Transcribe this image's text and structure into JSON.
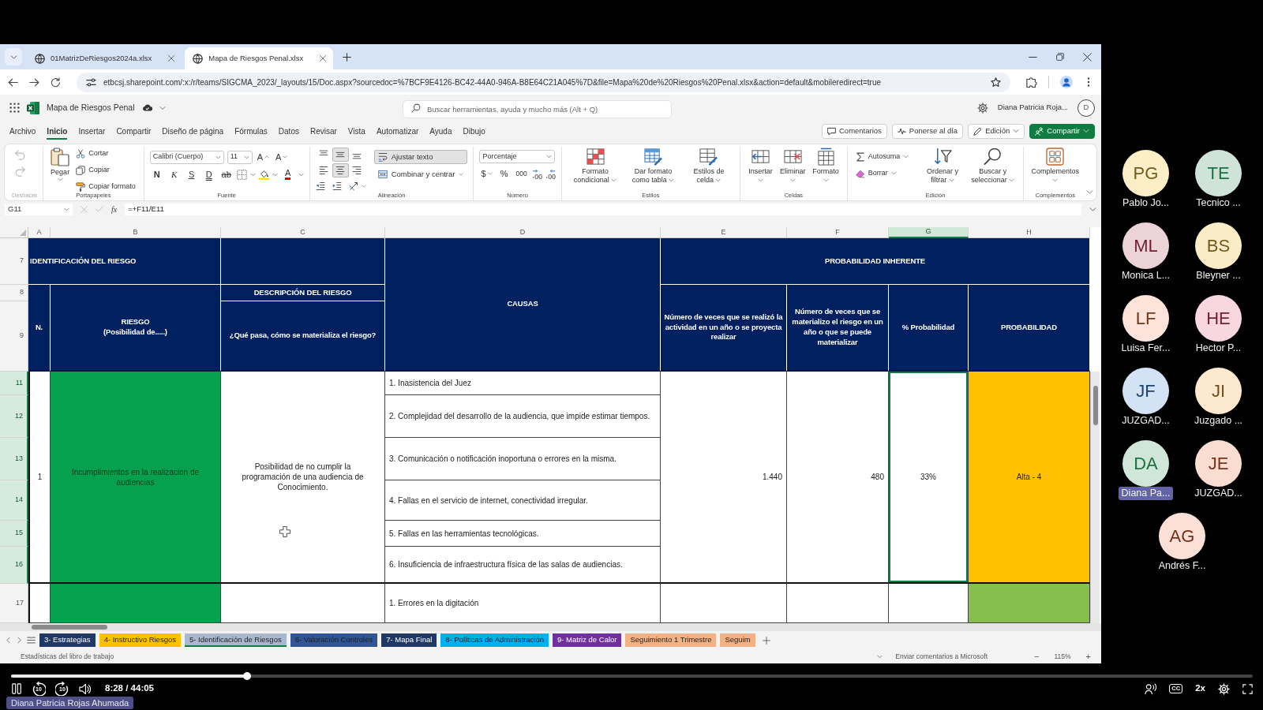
{
  "browser": {
    "tabs": [
      {
        "title": "01MatrizDeRiesgos2024a.xlsx",
        "selected": false
      },
      {
        "title": "Mapa de Riesgos Penal.xlsx",
        "selected": true
      }
    ],
    "url": "etbcsj.sharepoint.com/:x:/r/teams/SIGCMA_2023/_layouts/15/Doc.aspx?sourcedoc=%7BCF9E4126-BC42-44A0-946A-B8E64C21A045%7D&file=Mapa%20de%20Riesgos%20Penal.xlsx&action=default&mobileredirect=true"
  },
  "app": {
    "file_name": "Mapa de Riesgos Penal",
    "search": {
      "placeholder": "Buscar herramientas, ayuda y mucho más (Alt + Q)"
    },
    "user_name": "Diana Patricia Roja...",
    "user_initial": "D"
  },
  "menu_tabs": [
    {
      "label": "Archivo",
      "selected": false
    },
    {
      "label": "Inicio",
      "selected": true
    },
    {
      "label": "Insertar",
      "selected": false
    },
    {
      "label": "Compartir",
      "selected": false
    },
    {
      "label": "Diseño de página",
      "selected": false
    },
    {
      "label": "Fórmulas",
      "selected": false
    },
    {
      "label": "Datos",
      "selected": false
    },
    {
      "label": "Revisar",
      "selected": false
    },
    {
      "label": "Vista",
      "selected": false
    },
    {
      "label": "Automatizar",
      "selected": false
    },
    {
      "label": "Ayuda",
      "selected": false
    },
    {
      "label": "Dibujo",
      "selected": false
    }
  ],
  "actions": [
    {
      "label": "Comentarios",
      "kind": "comments"
    },
    {
      "label": "Ponerse al día",
      "kind": "catch-up"
    },
    {
      "label": "Edición",
      "kind": "mode"
    },
    {
      "label": "Compartir",
      "kind": "share"
    }
  ],
  "ribbon": [
    {
      "label": "Deshacer",
      "kind": "undo",
      "disabled": true
    },
    {
      "label": "Portapapeles",
      "kind": "clipboard",
      "paste": "Pegar",
      "items": [
        {
          "label": "Cortar",
          "kind": "cut"
        },
        {
          "label": "Copiar",
          "kind": "copy"
        },
        {
          "label": "Copiar formato",
          "kind": "format-painter"
        }
      ]
    },
    {
      "label": "Fuente",
      "kind": "font",
      "font": "Calibri (Cuerpo)",
      "size": "11",
      "grow": "A",
      "shrink": "A",
      "styles": [
        {
          "label": "N",
          "kind": "bold"
        },
        {
          "label": "K",
          "kind": "italic"
        },
        {
          "label": "S",
          "kind": "underline"
        },
        {
          "label": "D",
          "kind": "double-underline"
        },
        {
          "label": "ab",
          "kind": "strikethrough"
        }
      ],
      "font_color": "A"
    },
    {
      "label": "Alineación",
      "kind": "alignment",
      "vertical_align": [
        {
          "kind": "top",
          "selected": false
        },
        {
          "kind": "middle",
          "selected": true
        },
        {
          "kind": "bottom",
          "selected": false
        }
      ],
      "horizontal_align": [
        {
          "kind": "left",
          "selected": false
        },
        {
          "kind": "center",
          "selected": true
        },
        {
          "kind": "right",
          "selected": false
        }
      ],
      "wrap": {
        "label": "Ajustar texto",
        "on": true
      },
      "merge": "Combinar y centrar"
    },
    {
      "label": "Número",
      "kind": "number",
      "format": "Porcentaje",
      "symbols": [
        {
          "label": "$",
          "kind": "currency"
        },
        {
          "label": "%",
          "kind": "percent"
        },
        {
          "label": "000",
          "kind": "thousands"
        }
      ]
    },
    {
      "label": "Estilos",
      "kind": "buttons",
      "items": [
        {
          "label": "Formato condicional",
          "kind": "conditional"
        },
        {
          "label": "Dar formato como tabla",
          "kind": "table"
        },
        {
          "label": "Estilos de celda",
          "kind": "cell-styles"
        }
      ]
    },
    {
      "label": "Celdas",
      "kind": "buttons",
      "items": [
        {
          "label": "Insertar",
          "kind": "insert"
        },
        {
          "label": "Eliminar",
          "kind": "delete"
        },
        {
          "label": "Formato",
          "kind": "format"
        }
      ]
    },
    {
      "label": "Edición",
      "kind": "buttons",
      "items": [
        {
          "label": "Autosuma",
          "kind": "autosum"
        },
        {
          "label": "Borrar",
          "kind": "clear"
        },
        {
          "label": "Ordenar y filtrar",
          "kind": "sort"
        },
        {
          "label": "Buscar y seleccionar",
          "kind": "find"
        }
      ]
    },
    {
      "label": "Complementos",
      "kind": "buttons",
      "items": [
        {
          "label": "Complementos",
          "kind": "add-ins"
        }
      ]
    }
  ],
  "formula_bar": {
    "name_box": "G11",
    "fx": "fx",
    "formula": "=+F11/E11"
  },
  "sheet": {
    "columns": [
      {
        "label": "A",
        "selected": false
      },
      {
        "label": "B",
        "selected": false
      },
      {
        "label": "C",
        "selected": false
      },
      {
        "label": "D",
        "selected": false
      },
      {
        "label": "E",
        "selected": false
      },
      {
        "label": "F",
        "selected": false
      },
      {
        "label": "G",
        "selected": true
      },
      {
        "label": "H",
        "selected": false
      }
    ],
    "rows": [
      {
        "label": "7",
        "selected": false
      },
      {
        "label": "8",
        "selected": false
      },
      {
        "label": "9",
        "selected": false
      },
      {
        "label": "11",
        "selected": true
      },
      {
        "label": "12",
        "selected": true
      },
      {
        "label": "13",
        "selected": true
      },
      {
        "label": "14",
        "selected": true
      },
      {
        "label": "15",
        "selected": true
      },
      {
        "label": "16",
        "selected": true
      },
      {
        "label": "17",
        "selected": false
      }
    ],
    "header": {
      "identification": "IDENTIFICACIÓN DEL RIESGO",
      "causes": "CAUSAS",
      "inherent_probability": "PROBABILIDAD INHERENTE",
      "number": "N.",
      "risk": "RIESGO\n(Posibilidad de.....)",
      "description_group": "DESCRIPCIÓN DEL RIESGO",
      "description": "¿Qué pasa, cómo se materializa el riesgo?",
      "times_performed": "Número de veces que se realizó la actividad en un año o se proyecta realizar",
      "times_materialized": "Número de veces que se materializo el riesgo en un año o que se puede materializar",
      "probability_pct": "% Probabilidad",
      "probability": "PROBABILIDAD"
    },
    "risks": [
      {
        "number": "1",
        "risk": "Incumplimientos en la realizacion de audiencias",
        "description": "Posibilidad de no cumplir la programación de una audiencia de Conocimiento.",
        "causes": [
          "1. Inasistencia del Juez",
          "2. Complejidad del desarrollo de la audiencia, que impide estimar tiempos.",
          "3. Comunicación o notificación inoportuna o errores en la misma.",
          "4. Fallas en el servicio de internet, conectividad irregular.",
          "5. Fallas en las herramientas tecnológicas.",
          "6. Insuficiencia de infraestructura física de las salas de audiencias."
        ],
        "times_performed": "1.440",
        "times_materialized": "480",
        "probability_pct": {
          "value": "33%",
          "selected": true
        },
        "probability": {
          "label": "Alta - 4",
          "color": "#ffc000"
        }
      },
      {
        "causes": [
          "1. Errores en la digitación"
        ],
        "probability_pct": {
          "selected": false
        },
        "probability": {
          "color": "#86bf4e"
        }
      }
    ]
  },
  "sheet_tabs": [
    {
      "label": "3- Estrategias",
      "color": "#203864",
      "selected": false
    },
    {
      "label": "4- Instructivo Riesgos",
      "color": "#ffc000",
      "selected": false
    },
    {
      "label": "5- Identificación de Riesgos",
      "color": "#a9b7cf",
      "selected": true
    },
    {
      "label": "6- Valoración Controles",
      "color": "#2f5597",
      "selected": false
    },
    {
      "label": "7- Mapa Final",
      "color": "#203864",
      "selected": false
    },
    {
      "label": "8- Políticas de Administración",
      "color": "#00b0f0",
      "selected": false
    },
    {
      "label": "9- Matriz de Calor",
      "color": "#7030a0",
      "selected": false
    },
    {
      "label": "Seguimiento 1 Trimestre",
      "color": "#f4b183",
      "selected": false
    },
    {
      "label": "Seguim",
      "color": "#f4b183",
      "selected": false
    }
  ],
  "status_bar": {
    "statistics": "Estadísticas del libro de trabajo",
    "feedback": "Enviar comentarios a Microsoft",
    "zoom_out": "−",
    "zoom": "115%",
    "zoom_in": "+"
  },
  "participants": [
    {
      "initials": "PG",
      "name": "Pablo Jo...",
      "color": "#fcefc7",
      "highlighted": false
    },
    {
      "initials": "TE",
      "name": "Tecnico ...",
      "color": "#cfe3d8",
      "highlighted": false
    },
    {
      "initials": "ML",
      "name": "Monica L...",
      "color": "#ecd3d8",
      "highlighted": false
    },
    {
      "initials": "BS",
      "name": "Bleyner ...",
      "color": "#fbecc8",
      "highlighted": false
    },
    {
      "initials": "LF",
      "name": "Luisa Fer...",
      "color": "#fde3d9",
      "highlighted": false
    },
    {
      "initials": "HE",
      "name": "Hector P...",
      "color": "#f9d7e0",
      "highlighted": false
    },
    {
      "initials": "JF",
      "name": "JUZGAD...",
      "color": "#d3e2f4",
      "highlighted": false
    },
    {
      "initials": "JI",
      "name": "Juzgado ...",
      "color": "#fde9cd",
      "highlighted": false
    },
    {
      "initials": "DA",
      "name": "Diana Pa...",
      "color": "#d0e6d9",
      "highlighted": true
    },
    {
      "initials": "JE",
      "name": "JUZGAD...",
      "color": "#f9ddd1",
      "highlighted": false
    },
    {
      "initials": "AG",
      "name": "Andrés F...",
      "color": "#fcdfd6",
      "highlighted": false
    }
  ],
  "video": {
    "progress": {
      "level": 0.19
    },
    "skip_back": "10",
    "skip_forward": "10",
    "time": "8:28 / 44:05",
    "captions": "CC",
    "speed": "2x",
    "speaker_tag": "Diana Patricia Rojas Ahumada"
  }
}
